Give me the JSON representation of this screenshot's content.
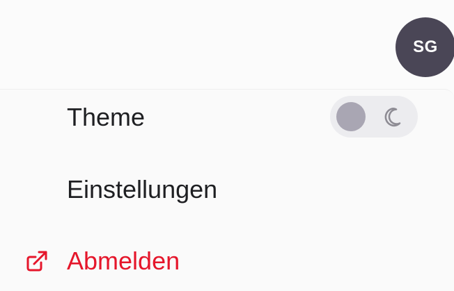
{
  "header": {
    "avatar_initials": "SG"
  },
  "menu": {
    "items": [
      {
        "label": "Theme"
      },
      {
        "label": "Einstellungen"
      },
      {
        "label": "Abmelden",
        "icon": "external-link-icon"
      }
    ],
    "theme_toggle": {
      "state": "light",
      "icon": "moon-icon"
    }
  },
  "colors": {
    "avatar_bg": "#4a4656",
    "danger": "#e5162b",
    "text": "#1e1f22"
  }
}
